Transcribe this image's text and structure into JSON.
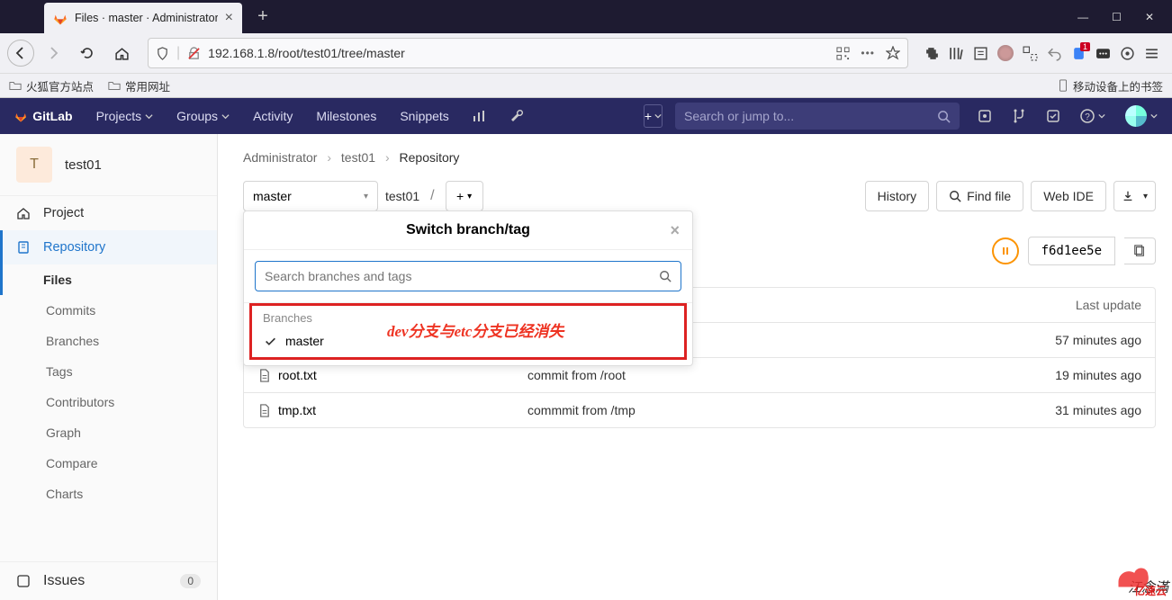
{
  "browser": {
    "tab_title": "Files · master · Administrator",
    "url": "192.168.1.8/root/test01/tree/master",
    "bookmarks": [
      "火狐官方站点",
      "常用网址"
    ],
    "mobile_bookmarks_label": "移动设备上的书签",
    "ext_badge": "1"
  },
  "gl_header": {
    "brand": "GitLab",
    "nav": {
      "projects": "Projects",
      "groups": "Groups",
      "activity": "Activity",
      "milestones": "Milestones",
      "snippets": "Snippets"
    },
    "search_placeholder": "Search or jump to..."
  },
  "sidebar": {
    "project_initial": "T",
    "project_name": "test01",
    "items": {
      "project": "Project",
      "repository": "Repository",
      "issues": "Issues"
    },
    "subitems": [
      "Files",
      "Commits",
      "Branches",
      "Tags",
      "Contributors",
      "Graph",
      "Compare",
      "Charts"
    ],
    "issues_count": "0"
  },
  "crumbs": {
    "a": "Administrator",
    "b": "test01",
    "c": "Repository"
  },
  "filebar": {
    "branch": "master",
    "path_root": "test01",
    "path_sep": "/",
    "history": "History",
    "find_file": "Find file",
    "web_ide": "Web IDE"
  },
  "commit": {
    "sha": "f6d1ee5e"
  },
  "table": {
    "hdr_name": "",
    "hdr_update": "Last update",
    "rows": [
      {
        "name": "",
        "kind": "folder",
        "commit": "",
        "time": "57 minutes ago"
      },
      {
        "name": "root.txt",
        "kind": "file",
        "commit": "commit from /root",
        "time": "19 minutes ago"
      },
      {
        "name": "tmp.txt",
        "kind": "file",
        "commit": "commmit from /tmp",
        "time": "31 minutes ago"
      }
    ]
  },
  "branch_pop": {
    "title": "Switch branch/tag",
    "search_placeholder": "Search branches and tags",
    "branches_label": "Branches",
    "selected": "master",
    "annotation_text": "dev分支与etc分支已经消失"
  },
  "watermark": {
    "author": "江念滿",
    "site": "亿速云"
  }
}
